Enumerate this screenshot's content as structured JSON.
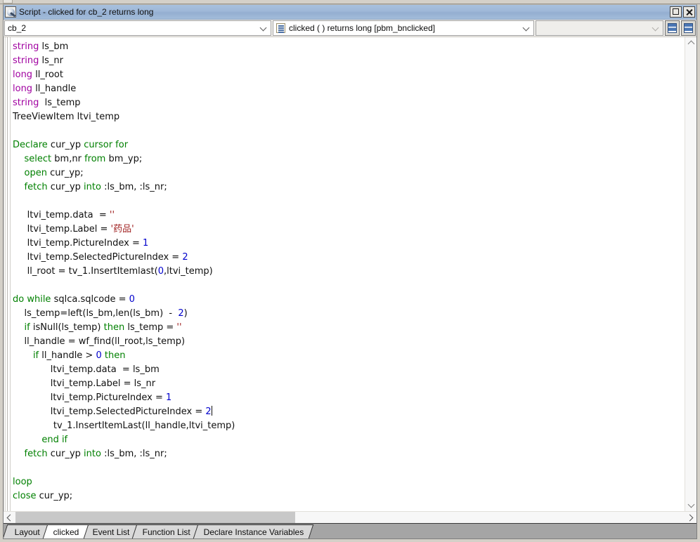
{
  "window": {
    "title": "Script - clicked for cb_2 returns long",
    "icon": "script-icon",
    "maximize_label": "maximize",
    "close_label": "close"
  },
  "toolbar": {
    "object_combo": {
      "value": "cb_2",
      "icon": "chevron-down-icon"
    },
    "event_combo": {
      "value": "clicked ( )  returns long [pbm_bnclicked]",
      "icon": "event-list-icon"
    },
    "third_combo": {
      "value": "",
      "icon": "chevron-down-icon"
    },
    "split_horizontal_label": "split-pane-horizontal",
    "split_vertical_label": "split-pane-vertical"
  },
  "code": {
    "lines": [
      [
        {
          "t": "string",
          "c": "type"
        },
        {
          "t": " ls_bm",
          "c": ""
        }
      ],
      [
        {
          "t": "string",
          "c": "type"
        },
        {
          "t": " ls_nr",
          "c": ""
        }
      ],
      [
        {
          "t": "long",
          "c": "type"
        },
        {
          "t": " ll_root",
          "c": ""
        }
      ],
      [
        {
          "t": "long",
          "c": "type"
        },
        {
          "t": " ll_handle",
          "c": ""
        }
      ],
      [
        {
          "t": "string",
          "c": "type"
        },
        {
          "t": "  ls_temp",
          "c": ""
        }
      ],
      [
        {
          "t": "TreeViewItem ltvi_temp",
          "c": ""
        }
      ],
      [],
      [
        {
          "t": "Declare",
          "c": "kw"
        },
        {
          "t": " cur_yp ",
          "c": ""
        },
        {
          "t": "cursor for",
          "c": "kw"
        }
      ],
      [
        {
          "t": "    ",
          "c": ""
        },
        {
          "t": "select",
          "c": "kw"
        },
        {
          "t": " bm,nr ",
          "c": ""
        },
        {
          "t": "from",
          "c": "kw"
        },
        {
          "t": " bm_yp;",
          "c": ""
        }
      ],
      [
        {
          "t": "    ",
          "c": ""
        },
        {
          "t": "open",
          "c": "kw"
        },
        {
          "t": " cur_yp;",
          "c": ""
        }
      ],
      [
        {
          "t": "    ",
          "c": ""
        },
        {
          "t": "fetch",
          "c": "kw"
        },
        {
          "t": " cur_yp ",
          "c": ""
        },
        {
          "t": "into",
          "c": "kw"
        },
        {
          "t": " :ls_bm, :ls_nr;",
          "c": ""
        }
      ],
      [],
      [
        {
          "t": "     ltvi_temp.data  = ",
          "c": ""
        },
        {
          "t": "''",
          "c": "str"
        }
      ],
      [
        {
          "t": "     ltvi_temp.Label = ",
          "c": ""
        },
        {
          "t": "'药品'",
          "c": "cn"
        }
      ],
      [
        {
          "t": "     ltvi_temp.PictureIndex = ",
          "c": ""
        },
        {
          "t": "1",
          "c": "num"
        }
      ],
      [
        {
          "t": "     ltvi_temp.SelectedPictureIndex = ",
          "c": ""
        },
        {
          "t": "2",
          "c": "num"
        }
      ],
      [
        {
          "t": "     ll_root = tv_1.InsertItemlast(",
          "c": ""
        },
        {
          "t": "0",
          "c": "num"
        },
        {
          "t": ",ltvi_temp)",
          "c": ""
        }
      ],
      [],
      [
        {
          "t": "do while",
          "c": "kw"
        },
        {
          "t": " sqlca.sqlcode = ",
          "c": ""
        },
        {
          "t": "0",
          "c": "num"
        }
      ],
      [
        {
          "t": "    ls_temp=left(ls_bm,len(ls_bm)  -  ",
          "c": ""
        },
        {
          "t": "2",
          "c": "num"
        },
        {
          "t": ")",
          "c": ""
        }
      ],
      [
        {
          "t": "    ",
          "c": ""
        },
        {
          "t": "if",
          "c": "kw"
        },
        {
          "t": " isNull(ls_temp) ",
          "c": ""
        },
        {
          "t": "then",
          "c": "kw"
        },
        {
          "t": " ls_temp = ",
          "c": ""
        },
        {
          "t": "''",
          "c": "str"
        }
      ],
      [
        {
          "t": "    ll_handle = wf_find(ll_root,ls_temp)",
          "c": ""
        }
      ],
      [
        {
          "t": "       ",
          "c": ""
        },
        {
          "t": "if",
          "c": "kw"
        },
        {
          "t": " ll_handle > ",
          "c": ""
        },
        {
          "t": "0",
          "c": "num"
        },
        {
          "t": " ",
          "c": ""
        },
        {
          "t": "then",
          "c": "kw"
        }
      ],
      [
        {
          "t": "             ltvi_temp.data  = ls_bm",
          "c": ""
        }
      ],
      [
        {
          "t": "             ltvi_temp.Label = ls_nr",
          "c": ""
        }
      ],
      [
        {
          "t": "             ltvi_temp.PictureIndex = ",
          "c": ""
        },
        {
          "t": "1",
          "c": "num"
        }
      ],
      [
        {
          "t": "             ltvi_temp.SelectedPictureIndex = ",
          "c": ""
        },
        {
          "t": "2",
          "c": "num"
        },
        {
          "t": "|CARET|",
          "c": "caret"
        }
      ],
      [
        {
          "t": "              tv_1.InsertItemLast(ll_handle,ltvi_temp)",
          "c": ""
        }
      ],
      [
        {
          "t": "          ",
          "c": ""
        },
        {
          "t": "end if",
          "c": "kw"
        }
      ],
      [
        {
          "t": "    ",
          "c": ""
        },
        {
          "t": "fetch",
          "c": "kw"
        },
        {
          "t": " cur_yp ",
          "c": ""
        },
        {
          "t": "into",
          "c": "kw"
        },
        {
          "t": " :ls_bm, :ls_nr;",
          "c": ""
        }
      ],
      [],
      [
        {
          "t": "loop",
          "c": "kw"
        }
      ],
      [
        {
          "t": "close",
          "c": "kw"
        },
        {
          "t": " cur_yp;",
          "c": ""
        }
      ]
    ]
  },
  "scrollbars": {
    "vertical_up_label": "scroll-up",
    "vertical_down_label": "scroll-down",
    "horizontal_left_label": "scroll-left",
    "horizontal_right_label": "scroll-right"
  },
  "tabs": [
    {
      "label": "Layout",
      "active": false
    },
    {
      "label": "clicked",
      "active": true
    },
    {
      "label": "Event List",
      "active": false
    },
    {
      "label": "Function List",
      "active": false
    },
    {
      "label": "Declare Instance Variables",
      "active": false
    }
  ],
  "colors": {
    "keyword": "#008000",
    "datatype": "#a000a0",
    "number": "#0000cc",
    "string": "#a02020",
    "titlebar": "#9fb8d8"
  }
}
